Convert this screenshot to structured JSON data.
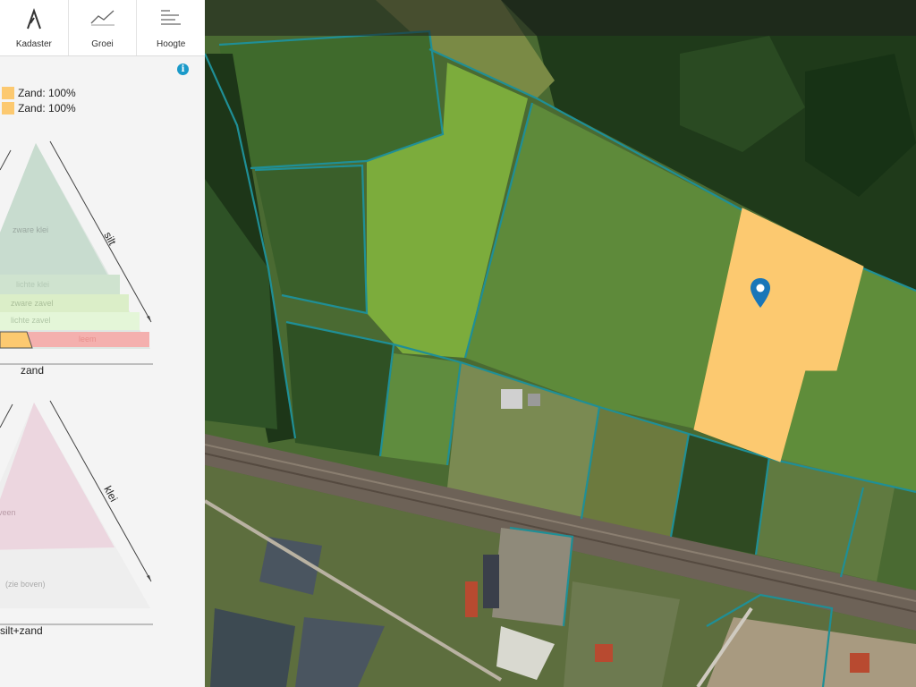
{
  "toolbar": {
    "tabs": [
      {
        "label": "Kadaster",
        "icon": "kadaster-icon"
      },
      {
        "label": "Groei",
        "icon": "growth-chart-icon"
      },
      {
        "label": "Hoogte",
        "icon": "height-lines-icon"
      }
    ]
  },
  "legend": {
    "rows": [
      "Zand: 100%",
      "Zand: 100%"
    ],
    "swatch_color": "#fcc970"
  },
  "triangle1": {
    "side_label": "silt",
    "bottom_label": "zand",
    "zones": [
      "zware klei",
      "lichte klei",
      "zware zavel",
      "lichte zavel",
      "leem"
    ]
  },
  "triangle2": {
    "side_label": "klei",
    "bottom_label": "silt+zand",
    "zones": [
      "veen",
      "(zie boven)"
    ]
  },
  "map": {
    "selected_parcel_color": "#fcc970",
    "parcel_border_color": "#1f8f96"
  }
}
